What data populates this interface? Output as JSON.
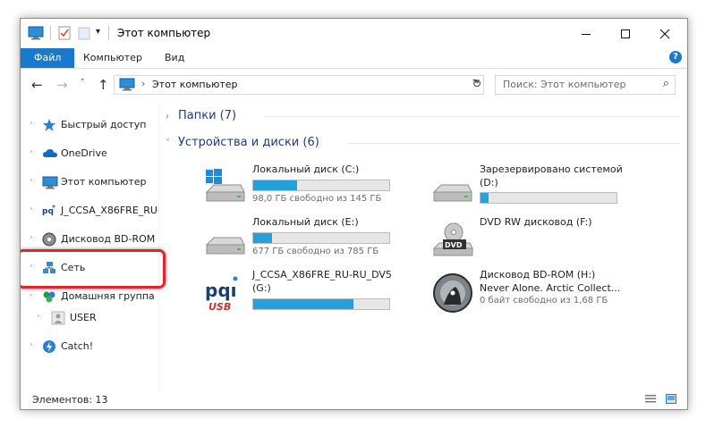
{
  "window": {
    "title": "Этот компьютер"
  },
  "ribbon": {
    "tabs": [
      "Файл",
      "Компьютер",
      "Вид"
    ],
    "help": "?"
  },
  "address": {
    "path": "Этот компьютер",
    "separator": "›"
  },
  "search": {
    "placeholder": "Поиск: Этот компьютер"
  },
  "nav": {
    "items": [
      {
        "label": "Быстрый доступ",
        "icon": "star-icon"
      },
      {
        "label": "OneDrive",
        "icon": "cloud-icon"
      },
      {
        "label": "Этот компьютер",
        "icon": "computer-icon"
      },
      {
        "label": "J_CCSA_X86FRE_RU-",
        "icon": "usb-drive-icon"
      },
      {
        "label": "Дисковод BD-ROM",
        "icon": "disc-icon"
      },
      {
        "label": "Сеть",
        "icon": "network-icon"
      },
      {
        "label": "Домашняя группа",
        "icon": "homegroup-icon"
      },
      {
        "label": "USER",
        "icon": "user-icon"
      },
      {
        "label": "Catch!",
        "icon": "catch-icon"
      }
    ]
  },
  "groups": {
    "folders": {
      "label": "Папки (7)"
    },
    "devices": {
      "label": "Устройства и диски (6)"
    }
  },
  "drives": [
    {
      "name": "Локальный диск (C:)",
      "free": "98,0 ГБ свободно из 145 ГБ",
      "used_fraction": 0.32,
      "icon": "windows-drive-icon"
    },
    {
      "name": "Локальный диск (E:)",
      "free": "677 ГБ свободно из 785 ГБ",
      "used_fraction": 0.14,
      "icon": "hard-drive-icon"
    },
    {
      "name": "J_CCSA_X86FRE_RU-RU_DV5",
      "name2": "(G:)",
      "used_fraction": 0.74,
      "icon": "pqi-usb-icon"
    },
    {
      "name": "Зарезервировано системой",
      "name2": "(D:)",
      "used_fraction": 0.06,
      "icon": "hard-drive-icon"
    },
    {
      "name": "DVD RW дисковод (F:)",
      "icon": "dvd-drive-icon"
    },
    {
      "name": "Дисковод BD-ROM (H:)",
      "name2": "Never Alone. Arctic Collect...",
      "free": "0 байт свободно из 1,68 ГБ",
      "icon": "bd-disc-icon"
    }
  ],
  "status": {
    "items_count": "Элементов: 13"
  },
  "colors": {
    "accent": "#1979ca",
    "bar_fill": "#26a0da",
    "highlight": "#e0262b"
  }
}
